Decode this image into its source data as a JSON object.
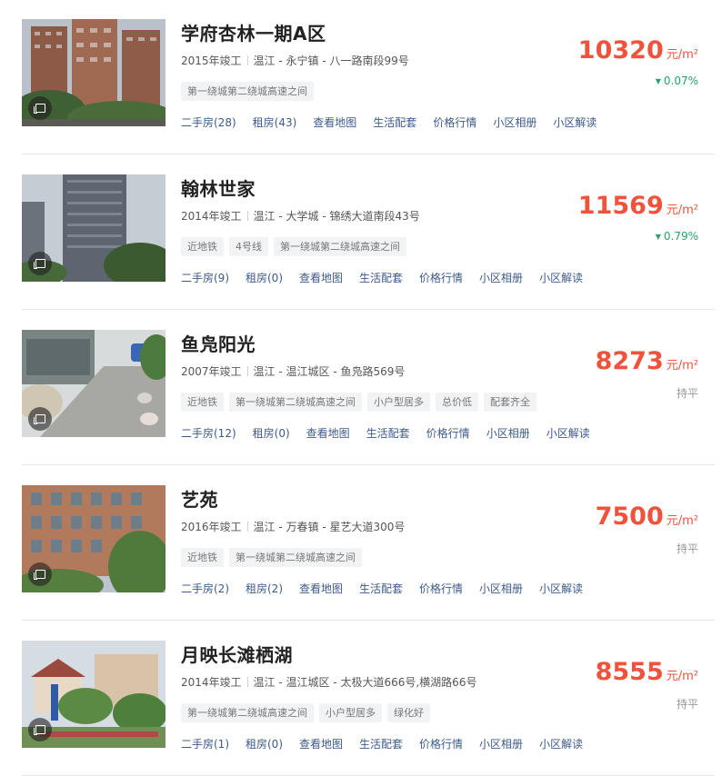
{
  "listings": [
    {
      "name": "学府杏林一期A区",
      "year": "2015年竣工",
      "location": "温江 - 永宁镇 - 八一路南段99号",
      "tags": [
        "第一绕城第二绕城高速之间"
      ],
      "links": [
        "二手房(28)",
        "租房(43)",
        "查看地图",
        "生活配套",
        "价格行情",
        "小区相册",
        "小区解读"
      ],
      "price": "10320",
      "unit": "元/m²",
      "change": "0.07%",
      "trend": "down"
    },
    {
      "name": "翰林世家",
      "year": "2014年竣工",
      "location": "温江 - 大学城 - 锦绣大道南段43号",
      "tags": [
        "近地铁",
        "4号线",
        "第一绕城第二绕城高速之间"
      ],
      "links": [
        "二手房(9)",
        "租房(0)",
        "查看地图",
        "生活配套",
        "价格行情",
        "小区相册",
        "小区解读"
      ],
      "price": "11569",
      "unit": "元/m²",
      "change": "0.79%",
      "trend": "down"
    },
    {
      "name": "鱼凫阳光",
      "year": "2007年竣工",
      "location": "温江 - 温江城区 - 鱼凫路569号",
      "tags": [
        "近地铁",
        "第一绕城第二绕城高速之间",
        "小户型居多",
        "总价低",
        "配套齐全"
      ],
      "links": [
        "二手房(12)",
        "租房(0)",
        "查看地图",
        "生活配套",
        "价格行情",
        "小区相册",
        "小区解读"
      ],
      "price": "8273",
      "unit": "元/m²",
      "change": "持平",
      "trend": "flat"
    },
    {
      "name": "艺苑",
      "year": "2016年竣工",
      "location": "温江 - 万春镇 - 星艺大道300号",
      "tags": [
        "近地铁",
        "第一绕城第二绕城高速之间"
      ],
      "links": [
        "二手房(2)",
        "租房(2)",
        "查看地图",
        "生活配套",
        "价格行情",
        "小区相册",
        "小区解读"
      ],
      "price": "7500",
      "unit": "元/m²",
      "change": "持平",
      "trend": "flat"
    },
    {
      "name": "月映长滩栖湖",
      "year": "2014年竣工",
      "location": "温江 - 温江城区 - 太极大道666号,横湖路66号",
      "tags": [
        "第一绕城第二绕城高速之间",
        "小户型居多",
        "绿化好"
      ],
      "links": [
        "二手房(1)",
        "租房(0)",
        "查看地图",
        "生活配套",
        "价格行情",
        "小区相册",
        "小区解读"
      ],
      "price": "8555",
      "unit": "元/m²",
      "change": "持平",
      "trend": "flat"
    }
  ],
  "icons": {
    "photo": "photo-album-icon",
    "trend_down": "triangle-down-icon"
  },
  "colors": {
    "price": "#f0523c",
    "trend_down": "#25a36a",
    "link": "#3d5a8a",
    "tag_bg": "#f2f3f5"
  }
}
